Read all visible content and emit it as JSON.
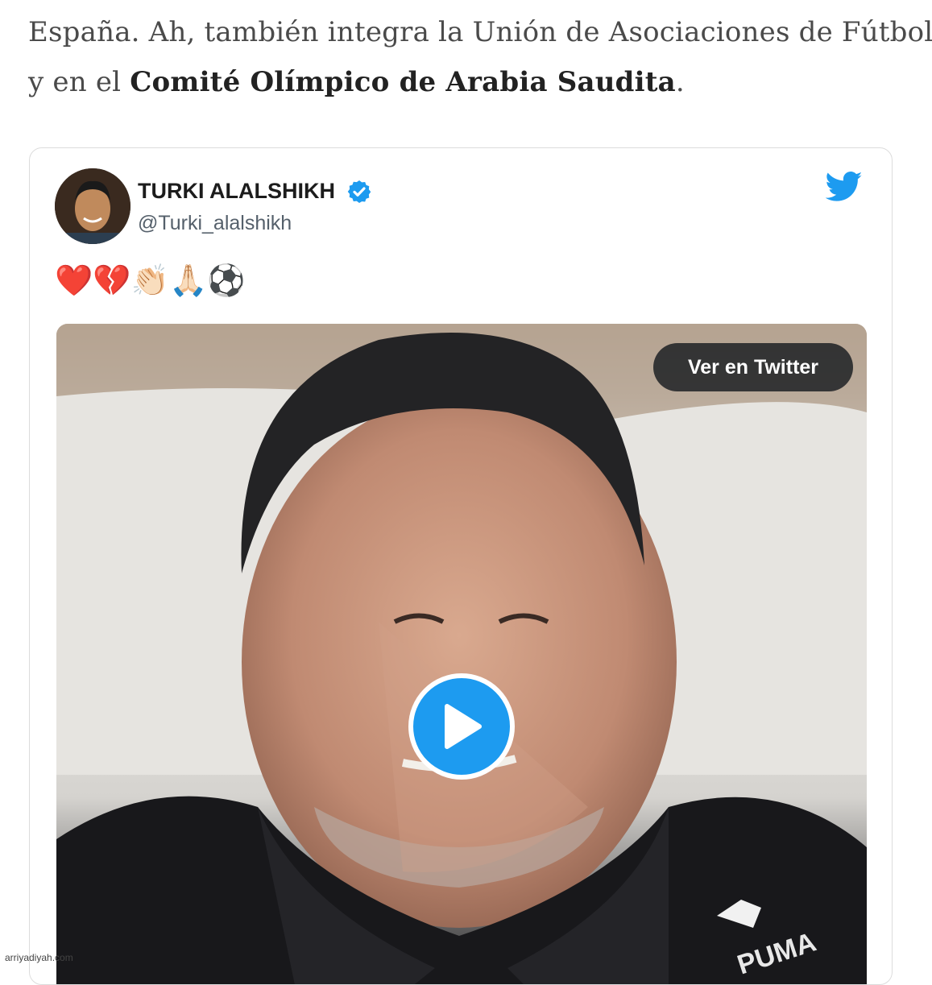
{
  "article": {
    "line1": "España. Ah, también integra la Unión de Asociaciones de Fútbol",
    "line2_prefix": "y en el ",
    "line2_bold": "Comité Olímpico de Arabia Saudita",
    "line2_suffix": "."
  },
  "tweet": {
    "display_name": "TURKI ALALSHIKH",
    "handle": "@Turki_alalshikh",
    "text": "❤️💔👏🏻🙏🏻⚽",
    "view_button_label": "Ver en Twitter",
    "brand_color": "#1d9bf0",
    "jersey_brand": "PUMA"
  },
  "watermark": "arriyadiyah.com",
  "icons": [
    "verified-badge-icon",
    "twitter-bird-icon",
    "play-icon"
  ]
}
